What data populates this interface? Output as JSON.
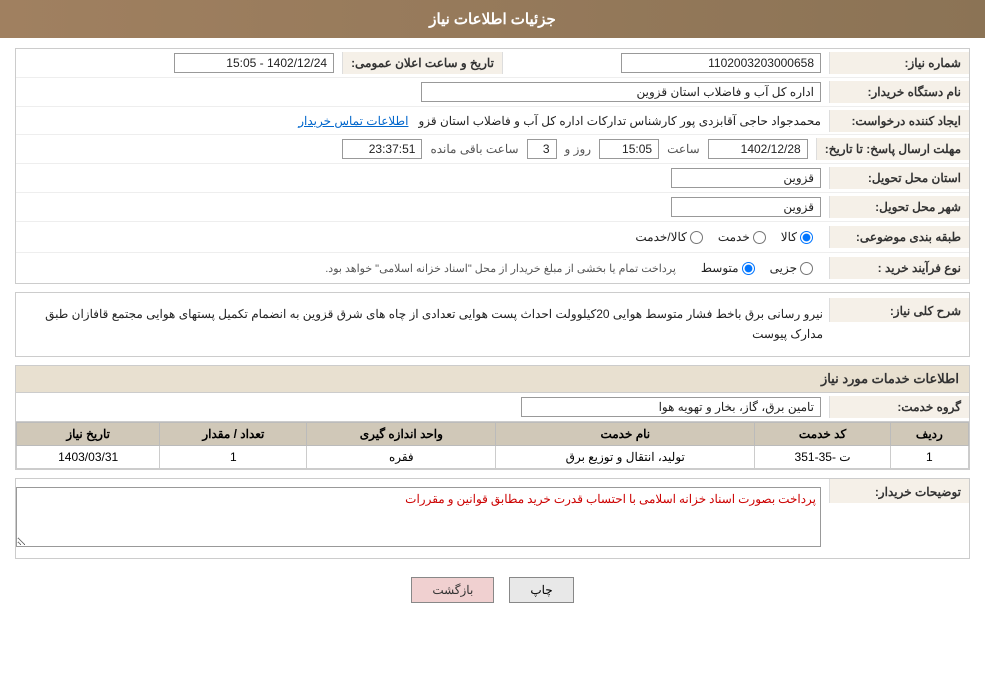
{
  "header": {
    "title": "جزئیات اطلاعات نیاز"
  },
  "fields": {
    "need_number_label": "شماره نیاز:",
    "need_number_value": "1102003203000658",
    "date_announce_label": "تاریخ و ساعت اعلان عمومی:",
    "date_announce_value": "1402/12/24 - 15:05",
    "buyer_org_label": "نام دستگاه خریدار:",
    "buyer_org_value": "اداره کل آب و فاضلاب استان قزوین",
    "creator_label": "ایجاد کننده درخواست:",
    "creator_value": "محمدجواد حاجی آقابزدی پور کارشناس تدارکات اداره کل آب و فاضلاب استان قزو",
    "creator_link": "اطلاعات تماس خریدار",
    "deadline_label": "مهلت ارسال پاسخ: تا تاریخ:",
    "deadline_date": "1402/12/28",
    "deadline_time_label": "ساعت",
    "deadline_time": "15:05",
    "deadline_days_label": "روز و",
    "deadline_days": "3",
    "deadline_remain_label": "ساعت باقی مانده",
    "deadline_remain": "23:37:51",
    "province_label": "استان محل تحویل:",
    "province_value": "قزوین",
    "city_label": "شهر محل تحویل:",
    "city_value": "قزوین",
    "category_label": "طبقه بندی موضوعی:",
    "category_options": [
      "کالا",
      "خدمت",
      "کالا/خدمت"
    ],
    "category_selected": "کالا",
    "purchase_type_label": "نوع فرآیند خرید :",
    "purchase_type_options": [
      "جزیی",
      "متوسط"
    ],
    "purchase_type_note": "پرداخت تمام یا بخشی از مبلغ خریدار از محل \"اسناد خزانه اسلامی\" خواهد بود.",
    "purchase_type_selected": "متوسط"
  },
  "general_description": {
    "section_label": "شرح کلی نیاز:",
    "text": "نیرو رسانی برق باخط فشار متوسط هوایی 20کیلوولت احداث پست هوایی تعدادی از چاه های شرق قزوین به انضمام تکمیل پستهای هوایی مجتمع قافازان طبق مدارک پیوست"
  },
  "services_section": {
    "title": "اطلاعات خدمات مورد نیاز",
    "service_group_label": "گروه خدمت:",
    "service_group_value": "تامین برق، گاز، بخار و تهویه هوا",
    "table": {
      "headers": [
        "ردیف",
        "کد خدمت",
        "نام خدمت",
        "واحد اندازه گیری",
        "تعداد / مقدار",
        "تاریخ نیاز"
      ],
      "rows": [
        {
          "row": "1",
          "code": "ت -35-351",
          "name": "تولید، انتقال و توزیع برق",
          "unit": "فقره",
          "quantity": "1",
          "date": "1403/03/31"
        }
      ]
    }
  },
  "buyer_description": {
    "label": "توضیحات خریدار:",
    "text": "پرداخت بصورت اسناد خزانه اسلامی با احتساب قدرت خرید مطابق قوانین و مقررات"
  },
  "buttons": {
    "print": "چاپ",
    "back": "بازگشت"
  }
}
